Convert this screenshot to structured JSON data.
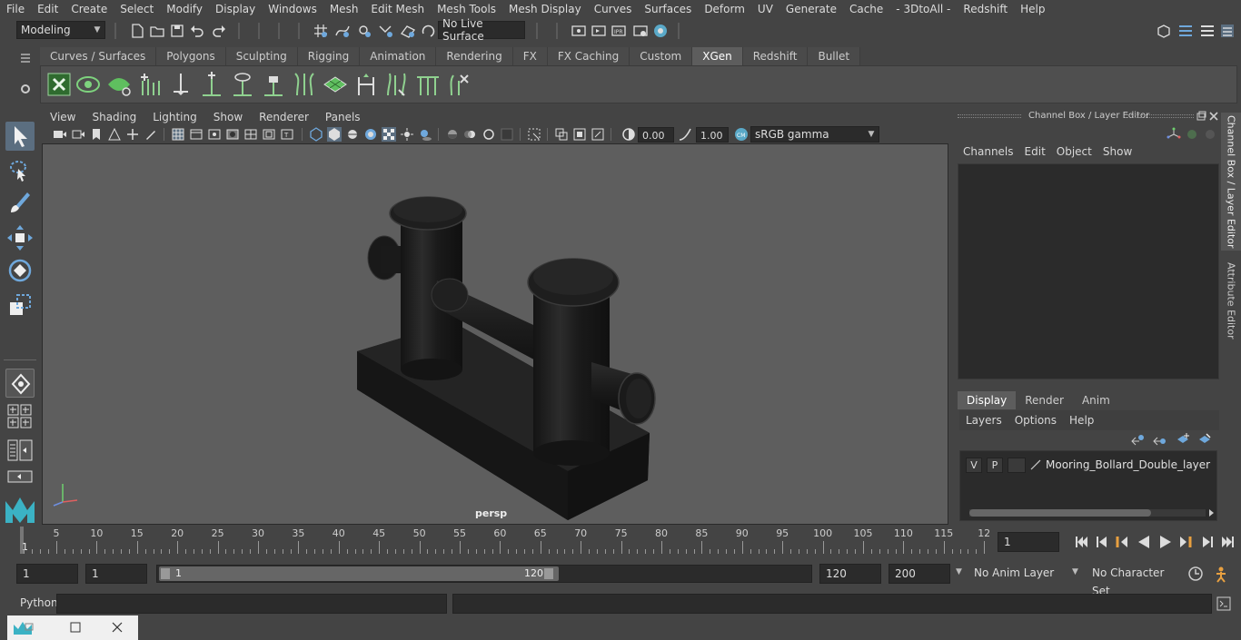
{
  "menubar": {
    "items": [
      "File",
      "Edit",
      "Create",
      "Select",
      "Modify",
      "Display",
      "Windows",
      "Mesh",
      "Edit Mesh",
      "Mesh Tools",
      "Mesh Display",
      "Curves",
      "Surfaces",
      "Deform",
      "UV",
      "Generate",
      "Cache",
      "- 3DtoAll -",
      "Redshift",
      "Help"
    ]
  },
  "statusline": {
    "mode": "Modeling",
    "live_surface": "No Live Surface"
  },
  "shelf": {
    "tabs": [
      "Curves / Surfaces",
      "Polygons",
      "Sculpting",
      "Rigging",
      "Animation",
      "Rendering",
      "FX",
      "FX Caching",
      "Custom",
      "XGen",
      "Redshift",
      "Bullet"
    ],
    "active_tab": "XGen"
  },
  "viewport": {
    "menu": [
      "View",
      "Shading",
      "Lighting",
      "Show",
      "Renderer",
      "Panels"
    ],
    "exposure": "0.00",
    "gamma": "1.00",
    "color_space": "sRGB gamma",
    "camera": "persp",
    "colors": {
      "background": "#5e5e5e",
      "object": "#1e1e1e",
      "highlight": "#5b6e80"
    }
  },
  "channel_box": {
    "title": "Channel Box / Layer Editor",
    "menu": [
      "Channels",
      "Edit",
      "Object",
      "Show"
    ]
  },
  "layer_editor": {
    "tabs": [
      "Display",
      "Render",
      "Anim"
    ],
    "active_tab": "Display",
    "menu": [
      "Layers",
      "Options",
      "Help"
    ],
    "layer": {
      "v": "V",
      "p": "P",
      "name": "Mooring_Bollard_Double_layer"
    }
  },
  "side_tabs": [
    "Channel Box / Layer Editor",
    "Attribute Editor"
  ],
  "time_slider": {
    "labels": [
      "5",
      "10",
      "15",
      "20",
      "25",
      "30",
      "35",
      "40",
      "45",
      "50",
      "55",
      "60",
      "65",
      "70",
      "75",
      "80",
      "85",
      "90",
      "95",
      "100",
      "105",
      "110",
      "115",
      "12"
    ],
    "start_label": "1",
    "current_frame": "1"
  },
  "range": {
    "start": "1",
    "playback_start": "1",
    "range_start_label": "1",
    "range_end_label": "120",
    "playback_end": "120",
    "end": "200",
    "anim_layer": "No Anim Layer",
    "char_set": "No Character Set"
  },
  "command_line": {
    "label": "Python"
  }
}
